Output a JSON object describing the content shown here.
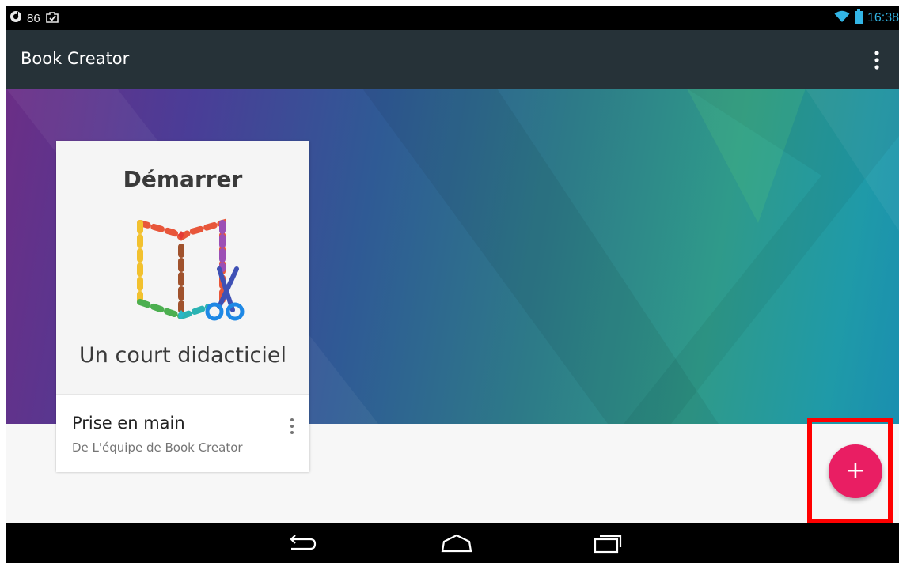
{
  "status_bar": {
    "notification_count": "86",
    "time": "16:38",
    "icons": [
      "app-notification-icon",
      "clipboard-icon",
      "wifi-icon",
      "battery-icon"
    ]
  },
  "app_bar": {
    "title": "Book Creator",
    "menu_icon": "overflow-menu-icon"
  },
  "book_card": {
    "cover_title": "Démarrer",
    "cover_subtitle": "Un court didacticiel",
    "title": "Prise en main",
    "author": "De L'équipe de Book Creator",
    "more_icon": "more-vert-icon"
  },
  "fab": {
    "label": "+",
    "color": "#e91e63"
  },
  "nav_bar": {
    "buttons": [
      "back-icon",
      "home-icon",
      "recents-icon"
    ]
  },
  "colors": {
    "app_bar": "#263238",
    "highlight": "#ff0000",
    "status_accent": "#33b5e5"
  }
}
